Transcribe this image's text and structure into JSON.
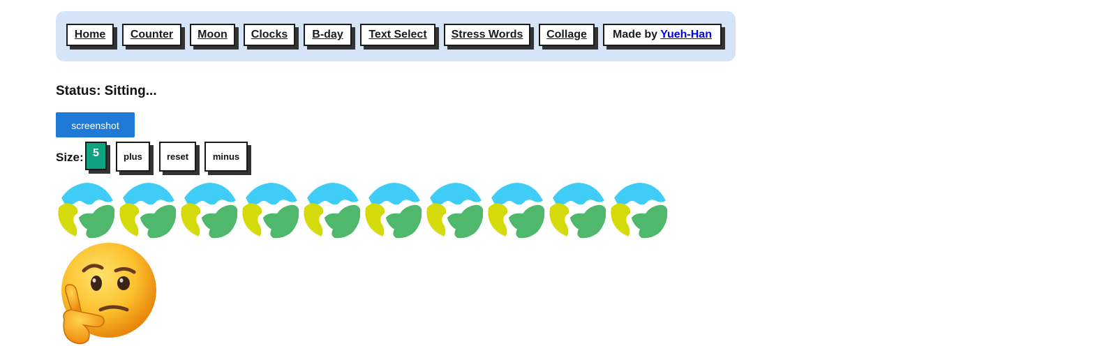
{
  "nav": {
    "items": [
      {
        "label": "Home"
      },
      {
        "label": "Counter"
      },
      {
        "label": "Moon"
      },
      {
        "label": "Clocks"
      },
      {
        "label": "B-day"
      },
      {
        "label": "Text Select"
      },
      {
        "label": "Stress Words"
      },
      {
        "label": "Collage"
      }
    ],
    "made_by_prefix": "Made by",
    "made_by_author": "Yueh-Han"
  },
  "status": {
    "text": "Status: Sitting..."
  },
  "screenshot_button": {
    "label": "screenshot"
  },
  "size": {
    "label": "Size:",
    "value": "5",
    "plus_label": "plus",
    "reset_label": "reset",
    "minus_label": "minus"
  },
  "globes": {
    "count": 10,
    "icon": "globe-icon"
  },
  "emoji": {
    "icon": "thinking-face-icon"
  },
  "colors": {
    "nav_bg": "#d6e4f8",
    "screenshot_bg": "#1e7ad4",
    "size_value_bg": "#10a37f",
    "link": "#0000ee",
    "globe_water": "#3fcdf8",
    "globe_land_yellow": "#d5da0b",
    "globe_land_green": "#4fb86c"
  }
}
